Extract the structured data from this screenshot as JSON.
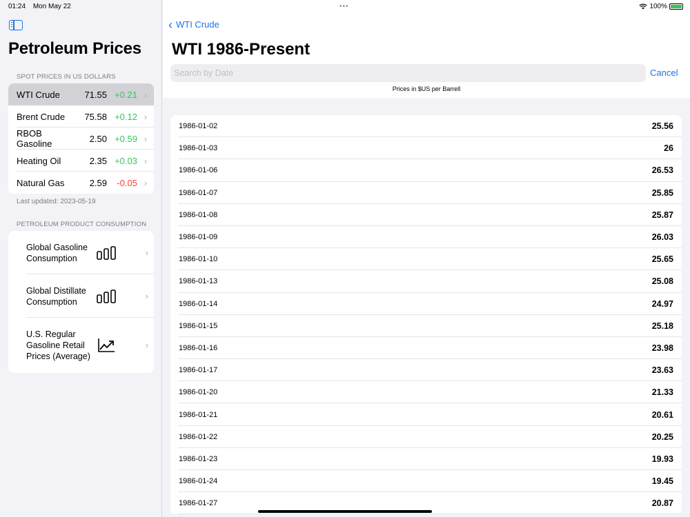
{
  "status": {
    "time": "01:24",
    "date": "Mon May 22",
    "battery": "100%"
  },
  "sidebar": {
    "title": "Petroleum Prices",
    "spot_header": "SPOT PRICES IN US DOLLARS",
    "spot": [
      {
        "name": "WTI Crude",
        "price": "71.55",
        "change": "+0.21"
      },
      {
        "name": "Brent Crude",
        "price": "75.58",
        "change": "+0.12"
      },
      {
        "name": "RBOB Gasoline",
        "price": "2.50",
        "change": "+0.59"
      },
      {
        "name": "Heating Oil",
        "price": "2.35",
        "change": "+0.03"
      },
      {
        "name": "Natural Gas",
        "price": "2.59",
        "change": "-0.05"
      }
    ],
    "last_updated": "Last updated: 2023-05-19",
    "consumption_header": "PETROLEUM PRODUCT CONSUMPTION",
    "consumption": [
      {
        "label": "Global Gasoline Consumption",
        "icon": "bar-chart-icon"
      },
      {
        "label": "Global Distillate Consumption",
        "icon": "bar-chart-icon"
      },
      {
        "label": "U.S. Regular Gasoline Retail Prices (Average)",
        "icon": "line-chart-icon"
      }
    ]
  },
  "colors": {
    "accent": "#1a73e8",
    "positive": "#34c759",
    "negative": "#ff3b30"
  },
  "main": {
    "back_label": "WTI Crude",
    "title": "WTI 1986-Present",
    "search_placeholder": "Search by Date",
    "cancel_label": "Cancel",
    "caption": "Prices in $US per Barrell",
    "rows": [
      {
        "date": "1986-01-02",
        "price": "25.56"
      },
      {
        "date": "1986-01-03",
        "price": "26"
      },
      {
        "date": "1986-01-06",
        "price": "26.53"
      },
      {
        "date": "1986-01-07",
        "price": "25.85"
      },
      {
        "date": "1986-01-08",
        "price": "25.87"
      },
      {
        "date": "1986-01-09",
        "price": "26.03"
      },
      {
        "date": "1986-01-10",
        "price": "25.65"
      },
      {
        "date": "1986-01-13",
        "price": "25.08"
      },
      {
        "date": "1986-01-14",
        "price": "24.97"
      },
      {
        "date": "1986-01-15",
        "price": "25.18"
      },
      {
        "date": "1986-01-16",
        "price": "23.98"
      },
      {
        "date": "1986-01-17",
        "price": "23.63"
      },
      {
        "date": "1986-01-20",
        "price": "21.33"
      },
      {
        "date": "1986-01-21",
        "price": "20.61"
      },
      {
        "date": "1986-01-22",
        "price": "20.25"
      },
      {
        "date": "1986-01-23",
        "price": "19.93"
      },
      {
        "date": "1986-01-24",
        "price": "19.45"
      },
      {
        "date": "1986-01-27",
        "price": "20.87"
      }
    ]
  }
}
